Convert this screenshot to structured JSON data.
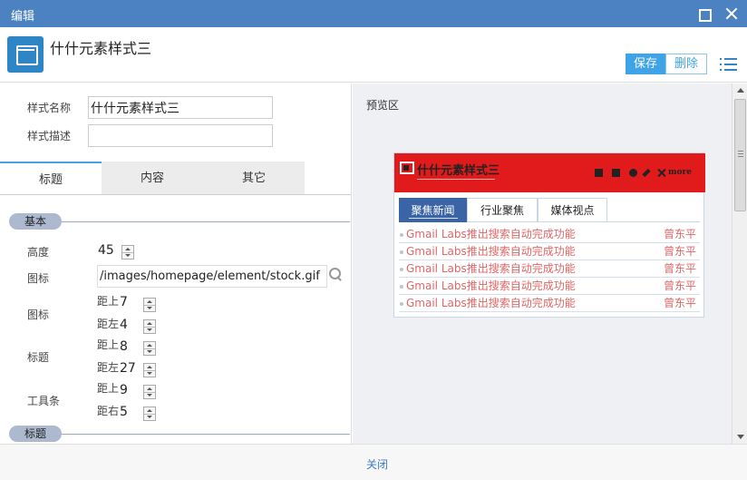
{
  "titlebar": {
    "title": "编辑"
  },
  "header": {
    "title": "什什元素样式三",
    "save_label": "保存",
    "delete_label": "删除"
  },
  "form": {
    "style_name_label": "样式名称",
    "style_name_value": "什什元素样式三",
    "style_desc_label": "样式描述",
    "style_desc_value": "",
    "tabs": [
      "标题",
      "内容",
      "其它"
    ],
    "active_tab": "标题",
    "section_basic": "基本",
    "height_label": "高度",
    "height_value": "45",
    "icon_path_label": "图标",
    "icon_path_value": "/images/homepage/element/stock.gif",
    "icon_group_label": "图标",
    "icon_top_label": "距上",
    "icon_top_value": "7",
    "icon_left_label": "距左",
    "icon_left_value": "4",
    "title_group_label": "标题",
    "title_top_label": "距上",
    "title_top_value": "8",
    "title_left_label": "距左",
    "title_left_value": "27",
    "toolbar_group_label": "工具条",
    "toolbar_top_label": "距上",
    "toolbar_top_value": "9",
    "toolbar_right_label": "距右",
    "toolbar_right_value": "5",
    "section_title": "标题"
  },
  "preview": {
    "label": "预览区",
    "widget_title": "什什元素样式三",
    "more_label": "more",
    "tabs": [
      "聚焦新闻",
      "行业聚焦",
      "媒体视点"
    ],
    "active_tab": "聚焦新闻",
    "rows": [
      {
        "title": "Gmail Labs推出搜索自动完成功能",
        "author": "曾东平"
      },
      {
        "title": "Gmail Labs推出搜索自动完成功能",
        "author": "曾东平"
      },
      {
        "title": "Gmail Labs推出搜索自动完成功能",
        "author": "曾东平"
      },
      {
        "title": "Gmail Labs推出搜索自动完成功能",
        "author": "曾东平"
      },
      {
        "title": "Gmail Labs推出搜索自动完成功能",
        "author": "曾东平"
      }
    ],
    "header_color": "#e11b1b",
    "tab_active_color": "#3a64a6",
    "row_text_color": "#e06666"
  },
  "footer": {
    "close_label": "关闭"
  },
  "colors": {
    "titlebar": "#4d82c2",
    "accent": "#3fa3e8"
  }
}
